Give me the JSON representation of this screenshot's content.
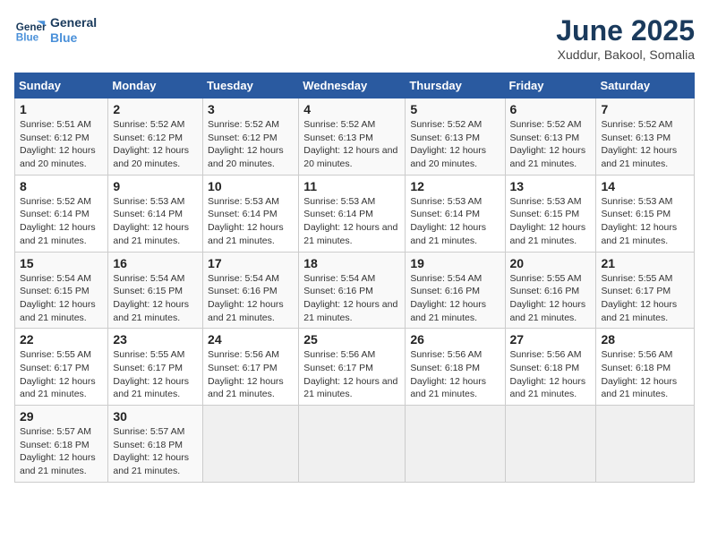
{
  "logo": {
    "line1": "General",
    "line2": "Blue"
  },
  "title": "June 2025",
  "subtitle": "Xuddur, Bakool, Somalia",
  "weekdays": [
    "Sunday",
    "Monday",
    "Tuesday",
    "Wednesday",
    "Thursday",
    "Friday",
    "Saturday"
  ],
  "weeks": [
    [
      {
        "day": "1",
        "sunrise": "5:51 AM",
        "sunset": "6:12 PM",
        "daylight": "12 hours and 20 minutes."
      },
      {
        "day": "2",
        "sunrise": "5:52 AM",
        "sunset": "6:12 PM",
        "daylight": "12 hours and 20 minutes."
      },
      {
        "day": "3",
        "sunrise": "5:52 AM",
        "sunset": "6:12 PM",
        "daylight": "12 hours and 20 minutes."
      },
      {
        "day": "4",
        "sunrise": "5:52 AM",
        "sunset": "6:13 PM",
        "daylight": "12 hours and 20 minutes."
      },
      {
        "day": "5",
        "sunrise": "5:52 AM",
        "sunset": "6:13 PM",
        "daylight": "12 hours and 20 minutes."
      },
      {
        "day": "6",
        "sunrise": "5:52 AM",
        "sunset": "6:13 PM",
        "daylight": "12 hours and 21 minutes."
      },
      {
        "day": "7",
        "sunrise": "5:52 AM",
        "sunset": "6:13 PM",
        "daylight": "12 hours and 21 minutes."
      }
    ],
    [
      {
        "day": "8",
        "sunrise": "5:52 AM",
        "sunset": "6:14 PM",
        "daylight": "12 hours and 21 minutes."
      },
      {
        "day": "9",
        "sunrise": "5:53 AM",
        "sunset": "6:14 PM",
        "daylight": "12 hours and 21 minutes."
      },
      {
        "day": "10",
        "sunrise": "5:53 AM",
        "sunset": "6:14 PM",
        "daylight": "12 hours and 21 minutes."
      },
      {
        "day": "11",
        "sunrise": "5:53 AM",
        "sunset": "6:14 PM",
        "daylight": "12 hours and 21 minutes."
      },
      {
        "day": "12",
        "sunrise": "5:53 AM",
        "sunset": "6:14 PM",
        "daylight": "12 hours and 21 minutes."
      },
      {
        "day": "13",
        "sunrise": "5:53 AM",
        "sunset": "6:15 PM",
        "daylight": "12 hours and 21 minutes."
      },
      {
        "day": "14",
        "sunrise": "5:53 AM",
        "sunset": "6:15 PM",
        "daylight": "12 hours and 21 minutes."
      }
    ],
    [
      {
        "day": "15",
        "sunrise": "5:54 AM",
        "sunset": "6:15 PM",
        "daylight": "12 hours and 21 minutes."
      },
      {
        "day": "16",
        "sunrise": "5:54 AM",
        "sunset": "6:15 PM",
        "daylight": "12 hours and 21 minutes."
      },
      {
        "day": "17",
        "sunrise": "5:54 AM",
        "sunset": "6:16 PM",
        "daylight": "12 hours and 21 minutes."
      },
      {
        "day": "18",
        "sunrise": "5:54 AM",
        "sunset": "6:16 PM",
        "daylight": "12 hours and 21 minutes."
      },
      {
        "day": "19",
        "sunrise": "5:54 AM",
        "sunset": "6:16 PM",
        "daylight": "12 hours and 21 minutes."
      },
      {
        "day": "20",
        "sunrise": "5:55 AM",
        "sunset": "6:16 PM",
        "daylight": "12 hours and 21 minutes."
      },
      {
        "day": "21",
        "sunrise": "5:55 AM",
        "sunset": "6:17 PM",
        "daylight": "12 hours and 21 minutes."
      }
    ],
    [
      {
        "day": "22",
        "sunrise": "5:55 AM",
        "sunset": "6:17 PM",
        "daylight": "12 hours and 21 minutes."
      },
      {
        "day": "23",
        "sunrise": "5:55 AM",
        "sunset": "6:17 PM",
        "daylight": "12 hours and 21 minutes."
      },
      {
        "day": "24",
        "sunrise": "5:56 AM",
        "sunset": "6:17 PM",
        "daylight": "12 hours and 21 minutes."
      },
      {
        "day": "25",
        "sunrise": "5:56 AM",
        "sunset": "6:17 PM",
        "daylight": "12 hours and 21 minutes."
      },
      {
        "day": "26",
        "sunrise": "5:56 AM",
        "sunset": "6:18 PM",
        "daylight": "12 hours and 21 minutes."
      },
      {
        "day": "27",
        "sunrise": "5:56 AM",
        "sunset": "6:18 PM",
        "daylight": "12 hours and 21 minutes."
      },
      {
        "day": "28",
        "sunrise": "5:56 AM",
        "sunset": "6:18 PM",
        "daylight": "12 hours and 21 minutes."
      }
    ],
    [
      {
        "day": "29",
        "sunrise": "5:57 AM",
        "sunset": "6:18 PM",
        "daylight": "12 hours and 21 minutes."
      },
      {
        "day": "30",
        "sunrise": "5:57 AM",
        "sunset": "6:18 PM",
        "daylight": "12 hours and 21 minutes."
      },
      null,
      null,
      null,
      null,
      null
    ]
  ]
}
